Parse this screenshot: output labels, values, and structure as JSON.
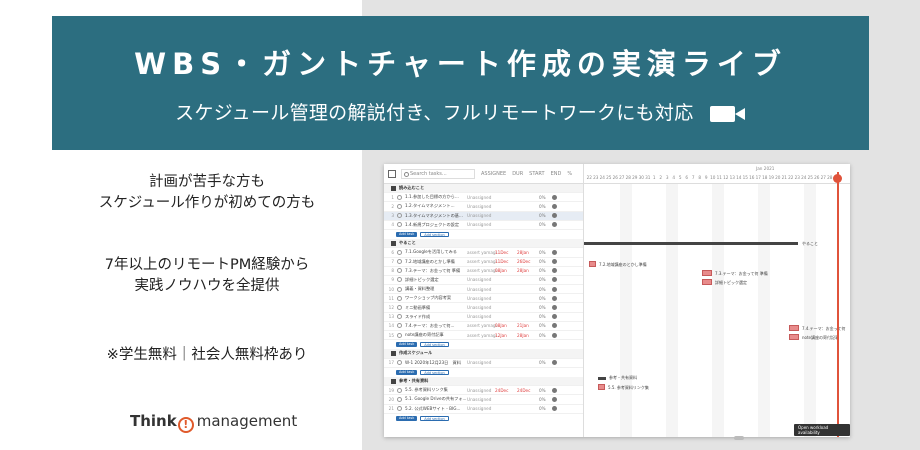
{
  "banner": {
    "title": "WBS・ガントチャート作成の実演ライブ",
    "subtitle": "スケジュール管理の解説付き、フルリモートワークにも対応",
    "camera_icon": "video-camera-icon"
  },
  "pitch": {
    "line1": "計画が苦手な方も",
    "line2": "スケジュール作りが初めての方も",
    "line3": "7年以上のリモートPM経験から",
    "line4": "実践ノウハウを全提供",
    "line5": "※学生無料｜社会人無料枠あり"
  },
  "logo": {
    "think": "Think",
    "mark": "!",
    "management": "management"
  },
  "app": {
    "search_placeholder": "Search tasks...",
    "columns": [
      "ASSIGNEE",
      "DUR",
      "START",
      "END",
      "%"
    ],
    "month_label": "Jan 2021",
    "days": [
      "22",
      "23",
      "24",
      "25",
      "26",
      "27",
      "28",
      "29",
      "30",
      "31",
      "1",
      "2",
      "3",
      "4",
      "5",
      "6",
      "7",
      "8",
      "9",
      "10",
      "11",
      "12",
      "13",
      "14",
      "15",
      "16",
      "17",
      "18",
      "19",
      "20",
      "21",
      "22",
      "23",
      "24",
      "25",
      "26",
      "27",
      "28"
    ],
    "sections": [
      {
        "name": "読み込むこと",
        "tasks": [
          {
            "num": "1",
            "name": "1.1.参加した目標の方から...",
            "assign": "Unassigned",
            "start": "",
            "end": "",
            "pct": "0%"
          },
          {
            "num": "2",
            "name": "1.2.タイムマネジメント...",
            "assign": "Unassigned",
            "start": "",
            "end": "",
            "pct": "0%"
          },
          {
            "num": "3",
            "name": "1.3.タイムマネジメントの基...",
            "assign": "Unassigned",
            "start": "",
            "end": "",
            "pct": "0%"
          },
          {
            "num": "4",
            "name": "1.4.新規プロジェクトの設定",
            "assign": "Unassigned",
            "start": "",
            "end": "",
            "pct": "0%"
          }
        ]
      },
      {
        "name": "やること",
        "tasks": [
          {
            "num": "6",
            "name": "7.1.Googleを活用してみる",
            "assign": "assert yamagi...",
            "start": "11Dec",
            "end": "28Jan",
            "pct": "0%"
          },
          {
            "num": "7",
            "name": "7.2.地域講座のとかし準備",
            "assign": "assert yamagi...",
            "start": "11Dec",
            "end": "26Dec",
            "pct": "0%"
          },
          {
            "num": "8",
            "name": "7.3.テーマ：お金って何 準備",
            "assign": "assert yamagi...",
            "start": "08Jan",
            "end": "28Jan",
            "pct": "0%"
          },
          {
            "num": "9",
            "name": "詳細トピック選定",
            "assign": "Unassigned",
            "start": "",
            "end": "",
            "pct": "0%"
          },
          {
            "num": "10",
            "name": "講義・資料整理",
            "assign": "Unassigned",
            "start": "",
            "end": "",
            "pct": "0%"
          },
          {
            "num": "11",
            "name": "ワークショップ内容考案",
            "assign": "Unassigned",
            "start": "",
            "end": "",
            "pct": "0%"
          },
          {
            "num": "12",
            "name": "ミニ動画準備",
            "assign": "Unassigned",
            "start": "",
            "end": "",
            "pct": "0%"
          },
          {
            "num": "13",
            "name": "スライド作成",
            "assign": "Unassigned",
            "start": "",
            "end": "",
            "pct": "0%"
          },
          {
            "num": "14",
            "name": "7.4.テーマ：お金って何...",
            "assign": "assert yamagi...",
            "start": "08Jan",
            "end": "21Jan",
            "pct": "0%"
          },
          {
            "num": "15",
            "name": "note講座の寄付記事",
            "assign": "assert yamagi...",
            "start": "12Jan",
            "end": "28Jan",
            "pct": "0%"
          }
        ]
      },
      {
        "name": "作成スケジュール",
        "tasks": [
          {
            "num": "17",
            "name": "W-1 2020年12月23日　資料",
            "assign": "Unassigned",
            "start": "",
            "end": "",
            "pct": "0%"
          }
        ]
      },
      {
        "name": "参考・共有資料",
        "tasks": [
          {
            "num": "19",
            "name": "5.5. 参考資料リンク集",
            "assign": "Unassigned",
            "start": "24Dec",
            "end": "24Dec",
            "pct": "0%"
          },
          {
            "num": "20",
            "name": "5.1. Google Driveの共有フォ...",
            "assign": "Unassigned",
            "start": "",
            "end": "",
            "pct": "0%"
          },
          {
            "num": "21",
            "name": "5.2. 公式WEBサイト - BIG...",
            "assign": "Unassigned",
            "start": "",
            "end": "",
            "pct": "0%"
          }
        ]
      }
    ],
    "add_task": "Add task",
    "add_section": "Add section",
    "gantt_labels": {
      "summary_yarukoto": "やること",
      "bar_72": "7.2.地域講座のとかし準備",
      "bar_73": "7.3.テーマ：お金って何 準備",
      "bar_detail": "詳細トピック選定",
      "bar_74": "7.4.テーマ：お金って何",
      "bar_note": "note講座の寄付記事",
      "ref_summary": "参考・共有資料",
      "ref_55": "5.5. 参考資料リンク集"
    },
    "workload_button": "Open workload availability"
  },
  "colors": {
    "banner": "#2c6e80",
    "accent_red": "#e0533b",
    "bar": "#e88b8b",
    "button_blue": "#2b6cb0"
  }
}
